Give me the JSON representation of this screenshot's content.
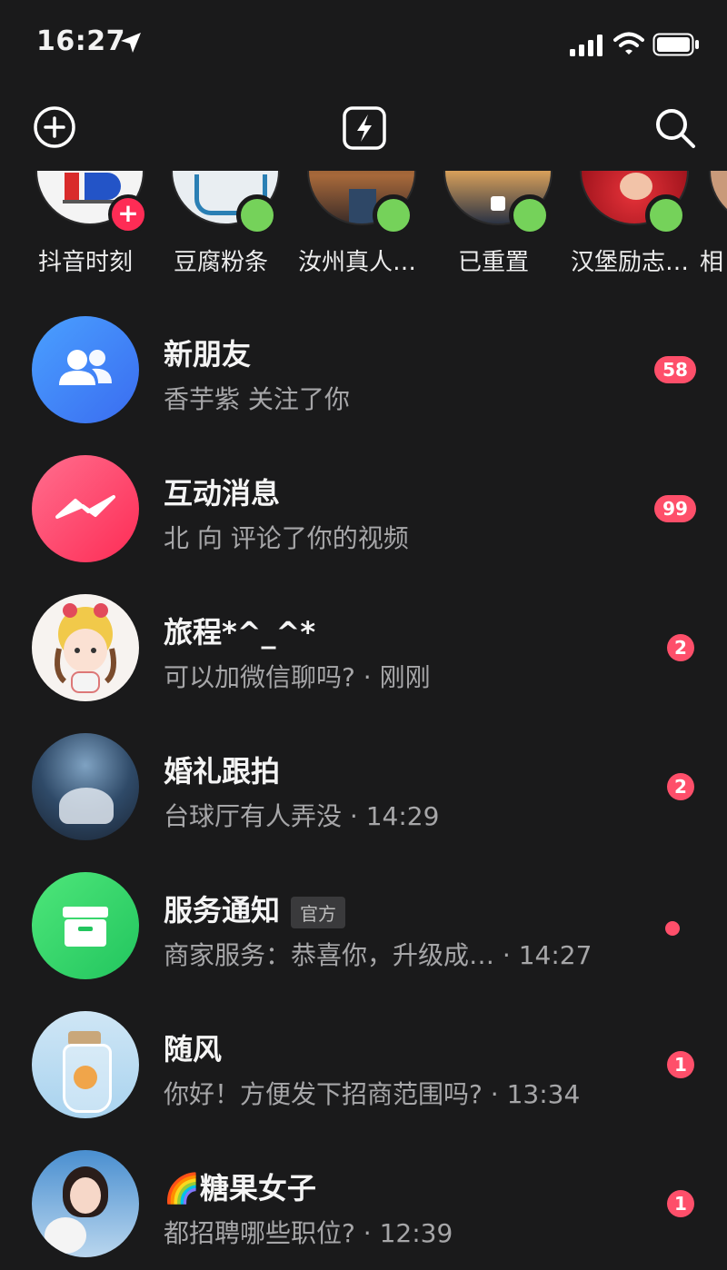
{
  "status": {
    "time": "16:27"
  },
  "stories": [
    {
      "label": "抖音时刻"
    },
    {
      "label": "豆腐粉条"
    },
    {
      "label": "汝州真人…"
    },
    {
      "label": "已重置"
    },
    {
      "label": "汉堡励志…"
    },
    {
      "label": "相"
    }
  ],
  "messages": [
    {
      "name": "新朋友",
      "preview": "香芋紫 关注了你",
      "badge": "58"
    },
    {
      "name": "互动消息",
      "preview": "北  向 评论了你的视频",
      "badge": "99"
    },
    {
      "name": "旅程*^_^*",
      "preview": "可以加微信聊吗? · 刚刚",
      "badge": "2"
    },
    {
      "name": "婚礼跟拍",
      "preview": "台球厅有人弄没 · 14:29",
      "badge": "2"
    },
    {
      "name": "服务通知",
      "tag": "官方",
      "preview": "商家服务：恭喜你，升级成…  · 14:27"
    },
    {
      "name": "随风",
      "preview": "你好！方便发下招商范围吗? · 13:34",
      "badge": "1"
    },
    {
      "name": "🌈糖果女子",
      "preview": "都招聘哪些职位? · 12:39",
      "badge": "1"
    }
  ],
  "colors": {
    "accent": "#fe2c55",
    "badge": "#fe4f6a",
    "online": "#75d25a"
  }
}
